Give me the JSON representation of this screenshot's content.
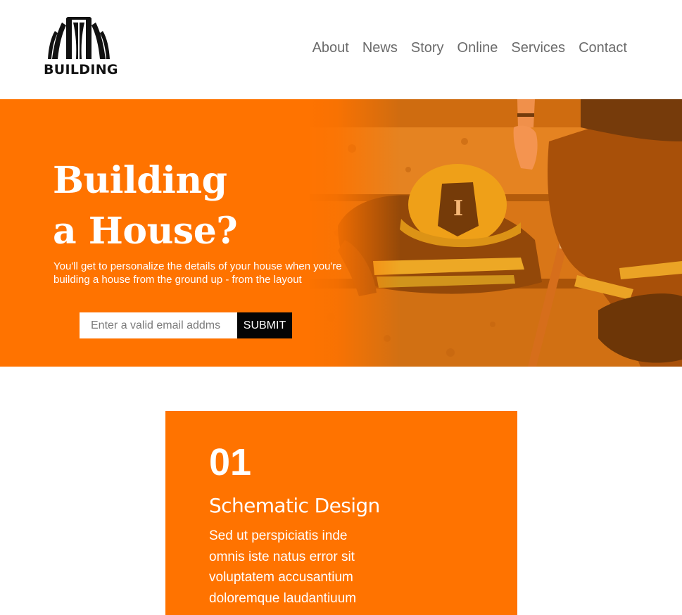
{
  "brand": {
    "logo_text": "BUILDING",
    "logo_icon": "building-arches-icon"
  },
  "nav": {
    "items": [
      "About",
      "News",
      "Story",
      "Online",
      "Services",
      "Contact"
    ]
  },
  "hero": {
    "title": "Building\na House?",
    "subtitle": "You'll get to personalize the details of your house when you're building a house from the ground up - from the layout",
    "image": "firefighter-resting-photo",
    "form": {
      "email_placeholder": "Enter a valid email addms",
      "submit_label": "SUBMIT"
    }
  },
  "feature_card": {
    "number": "01",
    "title": "Schematic Design",
    "body": "Sed ut perspiciatis inde omnis iste natus error sit voluptatem accusantium doloremque laudantiuum"
  },
  "colors": {
    "accent": "#ff7300",
    "button_bg": "#050505",
    "nav_text": "#6b6b6b"
  }
}
